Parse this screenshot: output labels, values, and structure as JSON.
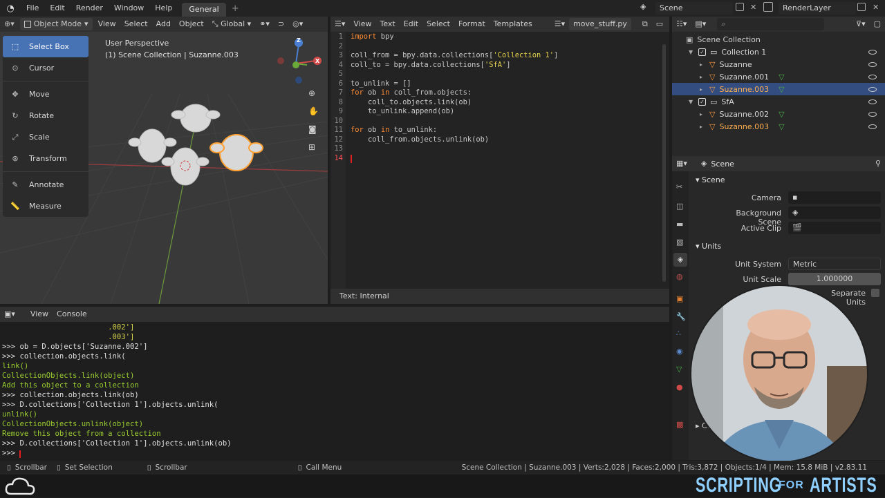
{
  "topbar": {
    "menus": [
      "File",
      "Edit",
      "Render",
      "Window",
      "Help"
    ],
    "workspace_tab": "General",
    "add_tab": "+",
    "scene_name": "Scene",
    "view_layer": "RenderLayer"
  },
  "viewport": {
    "mode": "Object Mode",
    "menus": [
      "View",
      "Select",
      "Add",
      "Object"
    ],
    "orientation": "Global",
    "perspective_label": "User Perspective",
    "scene_info": "(1) Scene Collection | Suzanne.003",
    "axis_x": "X",
    "axis_z": "Z",
    "tools": [
      "Select Box",
      "Cursor",
      "Move",
      "Rotate",
      "Scale",
      "Transform",
      "Annotate",
      "Measure"
    ]
  },
  "text_editor": {
    "menus": [
      "View",
      "Text",
      "Edit",
      "Select",
      "Format",
      "Templates"
    ],
    "filename": "move_stuff.py",
    "footer": "Text: Internal",
    "line_numbers": [
      "1",
      "2",
      "3",
      "4",
      "5",
      "6",
      "7",
      "8",
      "9",
      "10",
      "11",
      "12",
      "13",
      "14"
    ]
  },
  "console": {
    "menus": [
      "View",
      "Console"
    ],
    "lines": [
      {
        "text": "                        .002']",
        "color": "#d4d44a"
      },
      {
        "text": "                        .003']",
        "color": "#d4d44a"
      },
      {
        "text": ">>> ob = D.objects['Suzanne.002']",
        "color": "#e0e0e0"
      },
      {
        "text": ">>> collection.objects.link(",
        "color": "#e0e0e0"
      },
      {
        "text": "link()",
        "color": "#9acd32"
      },
      {
        "text": "CollectionObjects.link(object)",
        "color": "#9acd32"
      },
      {
        "text": "Add this object to a collection",
        "color": "#9acd32"
      },
      {
        "text": ">>> collection.objects.link(ob)",
        "color": "#e0e0e0"
      },
      {
        "text": ">>> D.collections['Collection 1'].objects.unlink(",
        "color": "#e0e0e0"
      },
      {
        "text": "unlink()",
        "color": "#9acd32"
      },
      {
        "text": "CollectionObjects.unlink(object)",
        "color": "#9acd32"
      },
      {
        "text": "Remove this object from a collection",
        "color": "#9acd32"
      },
      {
        "text": ">>> D.collections['Collection 1'].objects.unlink(ob)",
        "color": "#e0e0e0"
      },
      {
        "text": ">>> ",
        "color": "#e0e0e0"
      }
    ]
  },
  "outliner": {
    "root": "Scene Collection",
    "items": [
      {
        "label": "Collection 1",
        "indent": 1,
        "kind": "collection",
        "selected": false
      },
      {
        "label": "Suzanne",
        "indent": 2,
        "kind": "object",
        "selected": false
      },
      {
        "label": "Suzanne.001",
        "indent": 2,
        "kind": "object",
        "selected": false
      },
      {
        "label": "Suzanne.003",
        "indent": 2,
        "kind": "object",
        "selected": true
      },
      {
        "label": "SfA",
        "indent": 1,
        "kind": "collection",
        "selected": false
      },
      {
        "label": "Suzanne.002",
        "indent": 2,
        "kind": "object",
        "selected": false
      },
      {
        "label": "Suzanne.003",
        "indent": 2,
        "kind": "object",
        "selected": false
      }
    ]
  },
  "properties": {
    "context": "Scene",
    "panel_scene": "Scene",
    "camera_label": "Camera",
    "background_label": "Background Scene",
    "active_clip_label": "Active Clip",
    "panel_units": "Units",
    "unit_system_label": "Unit System",
    "unit_system_value": "Metric",
    "unit_scale_label": "Unit Scale",
    "unit_scale_value": "1.000000",
    "separate_units_label": "Separate Units",
    "cut_label": "Cu"
  },
  "statusbar": {
    "left": [
      "Scrollbar",
      "Set Selection",
      "Scrollbar",
      "Call Menu"
    ],
    "stats": "Scene Collection | Suzanne.003 | Verts:2,028 | Faces:2,000 | Tris:3,872 | Objects:1/4 | Mem: 15.8 MiB | v2.83.11"
  },
  "branding": {
    "word1": "SCRIPTING",
    "word2": "FOR",
    "word3": "ARTISTS"
  },
  "colors": {
    "accent": "#4772b3",
    "keyword": "#ff8c35",
    "string": "#e8d44d",
    "console_output": "#9acd32",
    "selection_outline": "#ffa033"
  }
}
